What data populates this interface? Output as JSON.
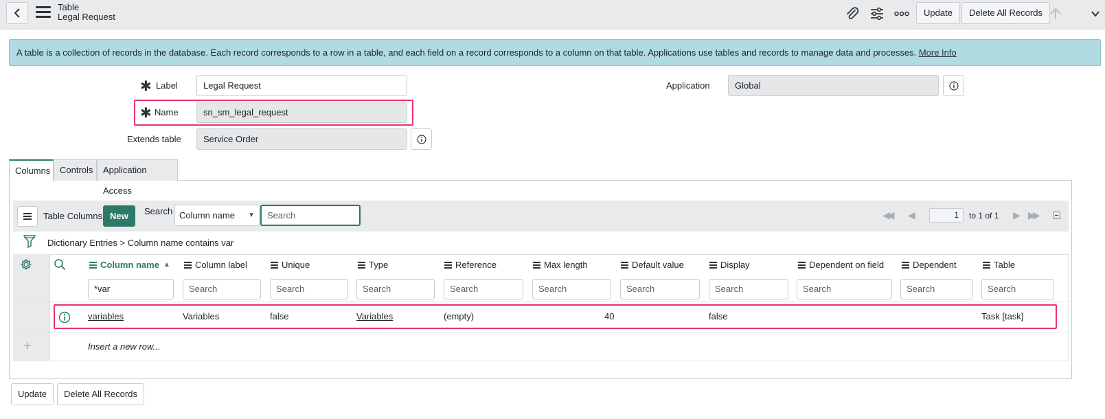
{
  "header": {
    "title_top": "Table",
    "title_bottom": "Legal Request",
    "update_label": "Update",
    "delete_all_label": "Delete All Records"
  },
  "banner": {
    "text": "A table is a collection of records in the database. Each record corresponds to a row in a table, and each field on a record corresponds to a column on that table. Applications use tables and records to manage data and processes.",
    "link": "More Info"
  },
  "form": {
    "label_label": "Label",
    "label_value": "Legal Request",
    "name_label": "Name",
    "name_value": "sn_sm_legal_request",
    "extends_label": "Extends table",
    "extends_value": "Service Order",
    "application_label": "Application",
    "application_value": "Global"
  },
  "tabs": [
    {
      "label": "Columns",
      "active": true
    },
    {
      "label": "Controls",
      "active": false
    },
    {
      "label": "Application Access",
      "active": false
    }
  ],
  "list": {
    "title": "Table Columns",
    "new_label": "New",
    "search_label": "Search",
    "search_field": "Column name",
    "search_placeholder": "Search",
    "page_value": "1",
    "page_range": "to 1 of 1",
    "breadcrumb_root": "Dictionary Entries",
    "breadcrumb_sep": ">",
    "breadcrumb_filter": "Column name contains var",
    "columns": [
      "Column name",
      "Column label",
      "Unique",
      "Type",
      "Reference",
      "Max length",
      "Default value",
      "Display",
      "Dependent on field",
      "Dependent",
      "Table"
    ],
    "filter_values": [
      "*var",
      "Search",
      "Search",
      "Search",
      "Search",
      "Search",
      "Search",
      "Search",
      "Search",
      "Search",
      "Search"
    ],
    "row": {
      "column_name": "variables",
      "column_label": "Variables",
      "unique": "false",
      "type": "Variables",
      "reference": "(empty)",
      "max_length": "40",
      "default_value": "",
      "display": "false",
      "dependent_on_field": "",
      "dependent": "",
      "table": "Task [task]"
    },
    "insert_label": "Insert a new row..."
  },
  "footer": {
    "update_label": "Update",
    "delete_all_label": "Delete All Records"
  },
  "colors": {
    "accent": "#2e7a69",
    "highlight": "#e8336a",
    "banner_bg": "#b1dbe2"
  },
  "icons": [
    "back-icon",
    "menu-icon",
    "paperclip-icon",
    "settings-sliders-icon",
    "more-icon",
    "arrow-up-icon",
    "chevron-down-icon",
    "info-icon",
    "gear-icon",
    "search-icon",
    "filter-icon",
    "first-page-icon",
    "prev-page-icon",
    "next-page-icon",
    "last-page-icon",
    "collapse-icon",
    "plus-icon"
  ]
}
